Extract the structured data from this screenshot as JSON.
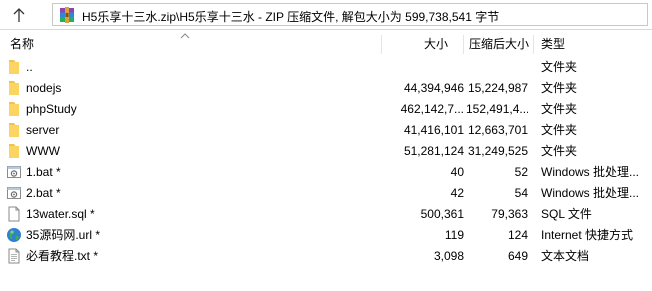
{
  "pathbar": {
    "path": "H5乐享十三水.zip\\H5乐享十三水 - ZIP 压缩文件, 解包大小为 599,738,541 字节"
  },
  "columns": {
    "name": "名称",
    "size": "大小",
    "packed": "压缩后大小",
    "type": "类型"
  },
  "rows": [
    {
      "icon": "folder-icon",
      "name": "..",
      "size": "",
      "packed": "",
      "type": "文件夹"
    },
    {
      "icon": "folder-icon",
      "name": "nodejs",
      "size": "44,394,946",
      "packed": "15,224,987",
      "type": "文件夹"
    },
    {
      "icon": "folder-icon",
      "name": "phpStudy",
      "size": "462,142,7...",
      "packed": "152,491,4...",
      "type": "文件夹"
    },
    {
      "icon": "folder-icon",
      "name": "server",
      "size": "41,416,101",
      "packed": "12,663,701",
      "type": "文件夹"
    },
    {
      "icon": "folder-icon",
      "name": "WWW",
      "size": "51,281,124",
      "packed": "31,249,525",
      "type": "文件夹"
    },
    {
      "icon": "batch-file-icon",
      "name": "1.bat *",
      "size": "40",
      "packed": "52",
      "type": "Windows 批处理..."
    },
    {
      "icon": "batch-file-icon",
      "name": "2.bat *",
      "size": "42",
      "packed": "54",
      "type": "Windows 批处理..."
    },
    {
      "icon": "document-icon",
      "name": "13water.sql *",
      "size": "500,361",
      "packed": "79,363",
      "type": "SQL 文件"
    },
    {
      "icon": "globe-icon",
      "name": "35源码网.url *",
      "size": "119",
      "packed": "124",
      "type": "Internet 快捷方式"
    },
    {
      "icon": "text-file-icon",
      "name": "必看教程.txt *",
      "size": "3,098",
      "packed": "649",
      "type": "文本文档"
    }
  ]
}
